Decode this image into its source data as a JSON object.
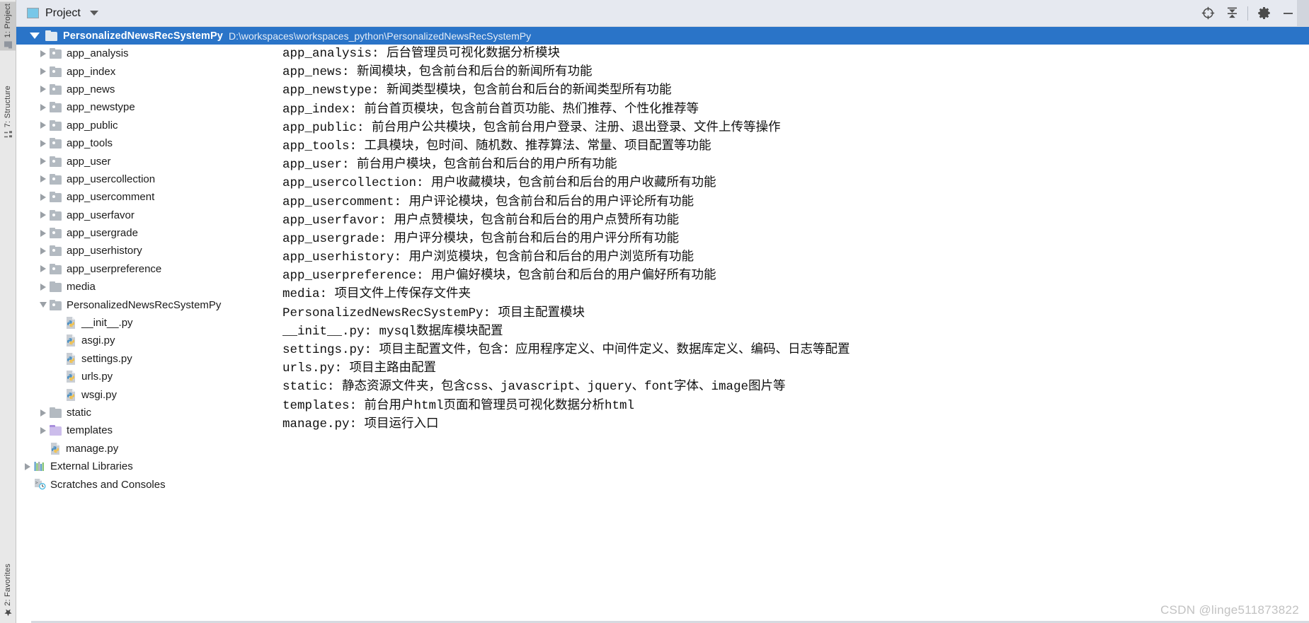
{
  "window": {
    "toolwindow_tabs": [
      {
        "label": "1: Project",
        "icon": "project-icon",
        "active": true
      },
      {
        "label": "7: Structure",
        "icon": "structure-icon",
        "active": false
      },
      {
        "label": "2: Favorites",
        "icon": "star-icon",
        "active": false
      }
    ]
  },
  "header": {
    "title": "Project",
    "dropdown_icon": "chevron-down-icon",
    "panel_icon": "project-panel-icon",
    "buttons": [
      {
        "name": "locate-icon",
        "label": "Select Opened File"
      },
      {
        "name": "collapse-all-icon",
        "label": "Collapse All"
      },
      {
        "name": "gear-icon",
        "label": "Settings"
      },
      {
        "name": "minimize-icon",
        "label": "Hide"
      }
    ]
  },
  "tree": {
    "root": {
      "name": "PersonalizedNewsRecSystemPy",
      "path": "D:\\workspaces\\workspaces_python\\PersonalizedNewsRecSystemPy",
      "expanded": true,
      "selected": true
    },
    "items": [
      {
        "label": "app_analysis",
        "icon": "folder-module-icon",
        "indent": 1,
        "arrow": "right",
        "kind": "folder-mod"
      },
      {
        "label": "app_index",
        "icon": "folder-module-icon",
        "indent": 1,
        "arrow": "right",
        "kind": "folder-mod"
      },
      {
        "label": "app_news",
        "icon": "folder-module-icon",
        "indent": 1,
        "arrow": "right",
        "kind": "folder-mod"
      },
      {
        "label": "app_newstype",
        "icon": "folder-module-icon",
        "indent": 1,
        "arrow": "right",
        "kind": "folder-mod"
      },
      {
        "label": "app_public",
        "icon": "folder-module-icon",
        "indent": 1,
        "arrow": "right",
        "kind": "folder-mod"
      },
      {
        "label": "app_tools",
        "icon": "folder-module-icon",
        "indent": 1,
        "arrow": "right",
        "kind": "folder-mod"
      },
      {
        "label": "app_user",
        "icon": "folder-module-icon",
        "indent": 1,
        "arrow": "right",
        "kind": "folder-mod"
      },
      {
        "label": "app_usercollection",
        "icon": "folder-module-icon",
        "indent": 1,
        "arrow": "right",
        "kind": "folder-mod"
      },
      {
        "label": "app_usercomment",
        "icon": "folder-module-icon",
        "indent": 1,
        "arrow": "right",
        "kind": "folder-mod"
      },
      {
        "label": "app_userfavor",
        "icon": "folder-module-icon",
        "indent": 1,
        "arrow": "right",
        "kind": "folder-mod"
      },
      {
        "label": "app_usergrade",
        "icon": "folder-module-icon",
        "indent": 1,
        "arrow": "right",
        "kind": "folder-mod"
      },
      {
        "label": "app_userhistory",
        "icon": "folder-module-icon",
        "indent": 1,
        "arrow": "right",
        "kind": "folder-mod"
      },
      {
        "label": "app_userpreference",
        "icon": "folder-module-icon",
        "indent": 1,
        "arrow": "right",
        "kind": "folder-mod"
      },
      {
        "label": "media",
        "icon": "folder-icon",
        "indent": 1,
        "arrow": "right",
        "kind": "folder"
      },
      {
        "label": "PersonalizedNewsRecSystemPy",
        "icon": "folder-module-icon",
        "indent": 1,
        "arrow": "down",
        "kind": "folder-mod"
      },
      {
        "label": "__init__.py",
        "icon": "python-file-icon",
        "indent": 2,
        "arrow": "none",
        "kind": "py"
      },
      {
        "label": "asgi.py",
        "icon": "python-file-icon",
        "indent": 2,
        "arrow": "none",
        "kind": "py"
      },
      {
        "label": "settings.py",
        "icon": "python-file-icon",
        "indent": 2,
        "arrow": "none",
        "kind": "py"
      },
      {
        "label": "urls.py",
        "icon": "python-file-icon",
        "indent": 2,
        "arrow": "none",
        "kind": "py"
      },
      {
        "label": "wsgi.py",
        "icon": "python-file-icon",
        "indent": 2,
        "arrow": "none",
        "kind": "py"
      },
      {
        "label": "static",
        "icon": "folder-icon",
        "indent": 1,
        "arrow": "right",
        "kind": "folder"
      },
      {
        "label": "templates",
        "icon": "folder-template-icon",
        "indent": 1,
        "arrow": "right",
        "kind": "folder-tpl"
      },
      {
        "label": "manage.py",
        "icon": "python-file-icon",
        "indent": 1,
        "arrow": "none",
        "kind": "py"
      },
      {
        "label": "External Libraries",
        "icon": "libraries-icon",
        "indent": 0,
        "arrow": "right",
        "kind": "libs"
      },
      {
        "label": "Scratches and Consoles",
        "icon": "scratches-icon",
        "indent": 0,
        "arrow": "none",
        "kind": "scratch"
      }
    ]
  },
  "description": {
    "lines": [
      "app_analysis: 后台管理员可视化数据分析模块",
      "app_news: 新闻模块，包含前台和后台的新闻所有功能",
      "app_newstype: 新闻类型模块，包含前台和后台的新闻类型所有功能",
      "app_index: 前台首页模块，包含前台首页功能、热们推荐、个性化推荐等",
      "app_public: 前台用户公共模块，包含前台用户登录、注册、退出登录、文件上传等操作",
      "app_tools: 工具模块，包时间、随机数、推荐算法、常量、项目配置等功能",
      "app_user: 前台用户模块，包含前台和后台的用户所有功能",
      "app_usercollection: 用户收藏模块，包含前台和后台的用户收藏所有功能",
      "app_usercomment: 用户评论模块，包含前台和后台的用户评论所有功能",
      "app_userfavor: 用户点赞模块，包含前台和后台的用户点赞所有功能",
      "app_usergrade: 用户评分模块，包含前台和后台的用户评分所有功能",
      "app_userhistory: 用户浏览模块，包含前台和后台的用户浏览所有功能",
      "app_userpreference: 用户偏好模块，包含前台和后台的用户偏好所有功能",
      "media: 项目文件上传保存文件夹",
      "PersonalizedNewsRecSystemPy: 项目主配置模块",
      "__init__.py: mysql数据库模块配置",
      "settings.py: 项目主配置文件，包含：应用程序定义、中间件定义、数据库定义、编码、日志等配置",
      "urls.py: 项目主路由配置",
      "static: 静态资源文件夹，包含css、javascript、jquery、font字体、image图片等",
      "templates: 前台用户html页面和管理员可视化数据分析html",
      "manage.py: 项目运行入口"
    ]
  },
  "watermark": {
    "text": "CSDN @linge511873822"
  },
  "colors": {
    "selection_blue": "#2a74c8",
    "header_bg": "#e6e9f0",
    "folder_gray": "#b3bac1",
    "folder_purple": "#ccbdeb",
    "text_dark": "#1b1b1b"
  }
}
